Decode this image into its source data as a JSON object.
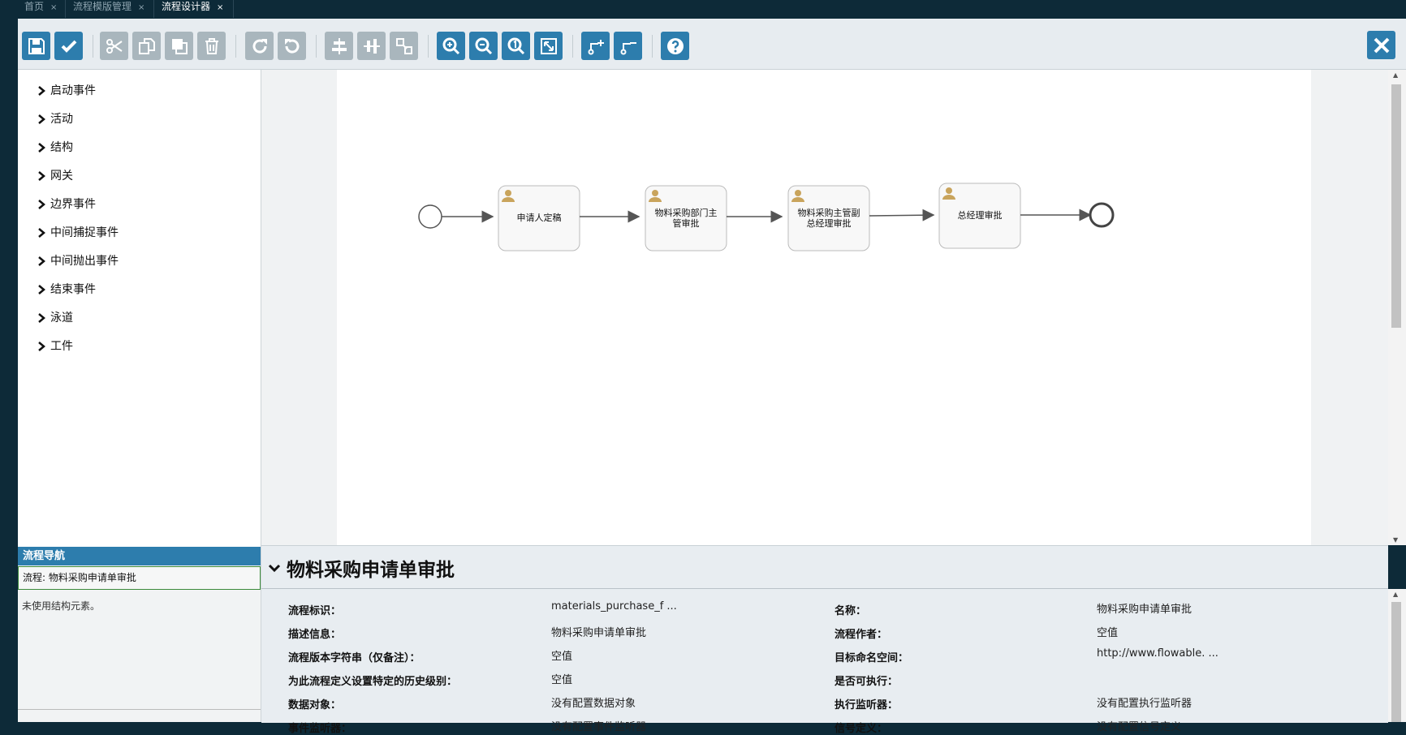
{
  "tabs": [
    {
      "label": "首页",
      "close": "×"
    },
    {
      "label": "流程模版管理",
      "close": "×"
    },
    {
      "label": "流程设计器",
      "close": "×"
    }
  ],
  "toolbar": {
    "buttons": [
      {
        "name": "save-icon",
        "enabled": true
      },
      {
        "name": "validate-check-icon",
        "enabled": true
      },
      {
        "name": "cut-icon",
        "enabled": false
      },
      {
        "name": "copy-icon",
        "enabled": false
      },
      {
        "name": "paste-icon",
        "enabled": false
      },
      {
        "name": "delete-icon",
        "enabled": false
      },
      {
        "name": "redo-icon",
        "enabled": false
      },
      {
        "name": "undo-icon",
        "enabled": false
      },
      {
        "name": "align-horizontal-icon",
        "enabled": false
      },
      {
        "name": "align-vertical-icon",
        "enabled": false
      },
      {
        "name": "same-size-icon",
        "enabled": false
      },
      {
        "name": "zoom-in-icon",
        "enabled": true
      },
      {
        "name": "zoom-out-icon",
        "enabled": true
      },
      {
        "name": "zoom-actual-icon",
        "enabled": true
      },
      {
        "name": "zoom-fit-icon",
        "enabled": true
      },
      {
        "name": "add-bendpoint-icon",
        "enabled": true
      },
      {
        "name": "remove-bendpoint-icon",
        "enabled": true
      },
      {
        "name": "help-icon",
        "enabled": true
      }
    ],
    "close_icon": "close-icon"
  },
  "palette": {
    "items": [
      "启动事件",
      "活动",
      "结构",
      "网关",
      "边界事件",
      "中间捕捉事件",
      "中间抛出事件",
      "结束事件",
      "泳道",
      "工件"
    ]
  },
  "navigator": {
    "title": "流程导航",
    "selected": "流程: 物料采购申请单审批",
    "note": "未使用结构元素。"
  },
  "diagram": {
    "tasks": [
      {
        "line1": "申请人定稿",
        "line2": ""
      },
      {
        "line1": "物料采购部门主",
        "line2": "管审批"
      },
      {
        "line1": "物料采购主管副",
        "line2": "总经理审批"
      },
      {
        "line1": "总经理审批",
        "line2": ""
      }
    ]
  },
  "properties": {
    "title": "物料采购申请单审批",
    "rows": [
      {
        "l1": "流程标识：",
        "v1": "materials_purchase_f ...",
        "l2": "名称：",
        "v2": "物料采购申请单审批"
      },
      {
        "l1": "描述信息：",
        "v1": "物料采购申请单审批",
        "l2": "流程作者：",
        "v2": "空值"
      },
      {
        "l1": "流程版本字符串（仅备注）：",
        "v1": "空值",
        "l2": "目标命名空间：",
        "v2": "http://www.flowable. ..."
      },
      {
        "l1": "为此流程定义设置特定的历史级别：",
        "v1": "空值",
        "l2": "是否可执行：",
        "v2": ""
      },
      {
        "l1": "数据对象：",
        "v1": "没有配置数据对象",
        "l2": "执行监听器：",
        "v2": "没有配置执行监听器"
      },
      {
        "l1": "事件监听器：",
        "v1": "没有配置事件监听器",
        "l2": "信号定义：",
        "v2": "没有配置信号定义"
      }
    ]
  },
  "colors": {
    "accent": "#2d7dad",
    "disabled": "#a9b6bd",
    "background": "#0d2a38"
  }
}
